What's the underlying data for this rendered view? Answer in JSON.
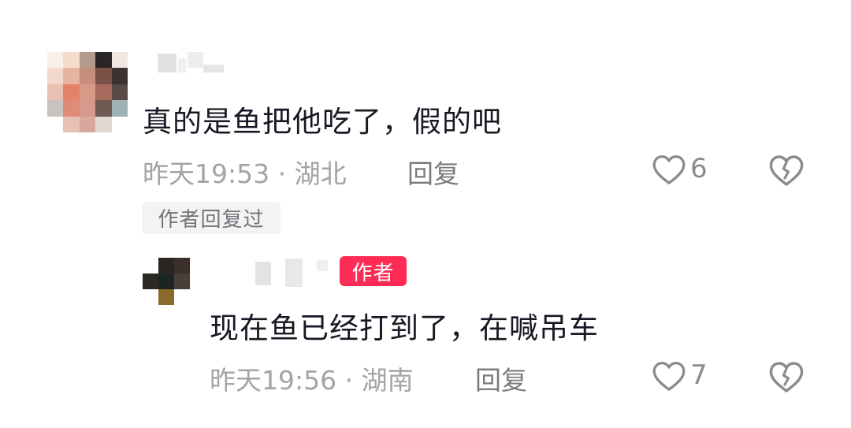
{
  "comments": [
    {
      "text": "真的是鱼把他吃了，假的吧",
      "meta": "昨天19:53 · 湖北",
      "reply_label": "回复",
      "likes": "6",
      "author_replied_label": "作者回复过",
      "replies": [
        {
          "badge": "作者",
          "text": "现在鱼已经打到了，在喊吊车",
          "meta": "昨天19:56 · 湖南",
          "reply_label": "回复",
          "likes": "7"
        }
      ]
    }
  ],
  "icons": {
    "like": "heart-outline-icon",
    "dislike": "broken-heart-icon"
  },
  "colors": {
    "author_badge": "#fe2c55",
    "meta_text": "#a3a3a8"
  }
}
